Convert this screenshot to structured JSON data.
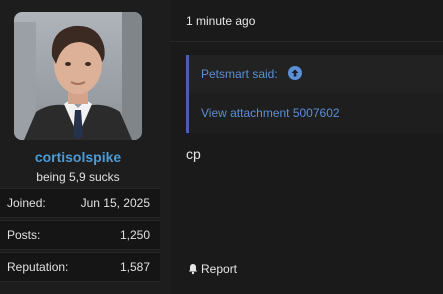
{
  "user": {
    "username": "cortisolspike",
    "title": "being 5,9 sucks"
  },
  "stats": [
    {
      "label": "Joined:",
      "value": "Jun 15, 2025"
    },
    {
      "label": "Posts:",
      "value": "1,250"
    },
    {
      "label": "Reputation:",
      "value": "1,587"
    }
  ],
  "post": {
    "timestamp": "1 minute ago",
    "quote": {
      "author": "Petsmart said:",
      "link": "View attachment 5007602"
    },
    "body": "cp",
    "report_label": "Report"
  },
  "colors": {
    "accent": "#4b9bd8",
    "quote_border": "#4a5fb3",
    "link": "#5b8fd6",
    "background": "#1a1a1a"
  },
  "icons": {
    "quote_jump": "arrow-up-circle-icon",
    "report": "bell-icon"
  }
}
